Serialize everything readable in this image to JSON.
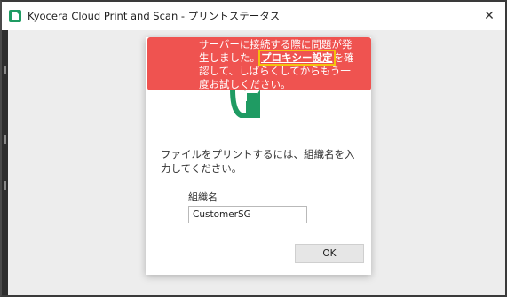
{
  "window": {
    "title": "Kyocera Cloud Print and Scan - プリントステータス",
    "close_glyph": "✕"
  },
  "banner": {
    "text_before": "サーバーに接続する際に問題が発生しました。",
    "link_text": "プロキシー設定",
    "text_after": "を確認して、しばらくしてからもう一度お試しください。",
    "color": "#ef5350",
    "highlight_color": "#f4c20d"
  },
  "dialog": {
    "prompt": "ファイルをプリントするには、組織名を入力してください。",
    "org_label": "組織名",
    "org_value": "CustomerSG",
    "ok_label": "OK"
  },
  "colors": {
    "brand": "#1f9b63"
  },
  "icons": {
    "app": "kyocera-app-icon",
    "logo": "kyocera-logo-icon",
    "close": "close-icon"
  }
}
